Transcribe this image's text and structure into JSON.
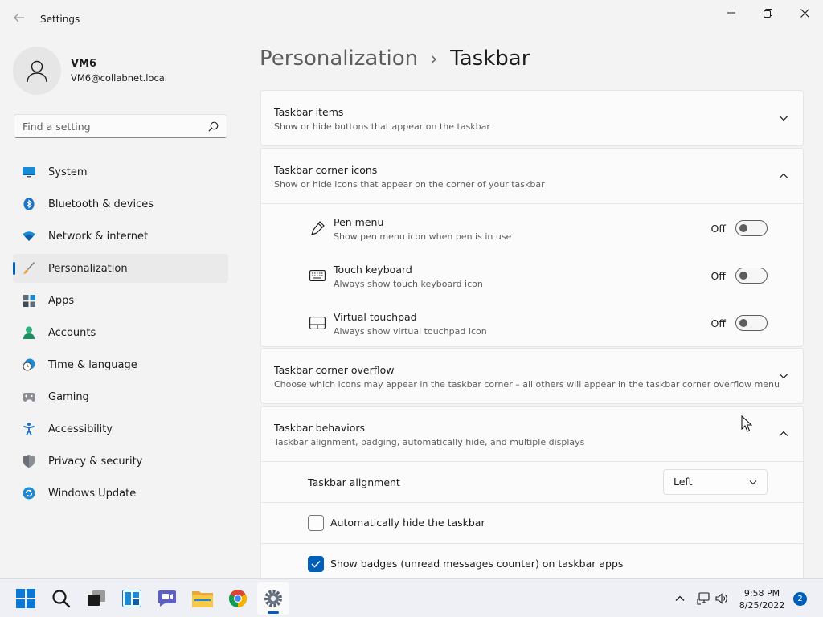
{
  "window": {
    "app_title": "Settings",
    "back_icon": "back-arrow-icon",
    "controls": [
      "minimize-icon",
      "restore-icon",
      "close-icon"
    ]
  },
  "profile": {
    "name": "VM6",
    "email": "VM6@collabnet.local"
  },
  "search": {
    "placeholder": "Find a setting",
    "value": ""
  },
  "sidebar": {
    "items": [
      {
        "label": "System",
        "icon": "monitor-icon",
        "active": false
      },
      {
        "label": "Bluetooth & devices",
        "icon": "bluetooth-icon",
        "active": false
      },
      {
        "label": "Network & internet",
        "icon": "wifi-icon",
        "active": false
      },
      {
        "label": "Personalization",
        "icon": "paintbrush-icon",
        "active": true
      },
      {
        "label": "Apps",
        "icon": "apps-icon",
        "active": false
      },
      {
        "label": "Accounts",
        "icon": "person-icon",
        "active": false
      },
      {
        "label": "Time & language",
        "icon": "clock-globe-icon",
        "active": false
      },
      {
        "label": "Gaming",
        "icon": "gamepad-icon",
        "active": false
      },
      {
        "label": "Accessibility",
        "icon": "accessibility-icon",
        "active": false
      },
      {
        "label": "Privacy & security",
        "icon": "shield-icon",
        "active": false
      },
      {
        "label": "Windows Update",
        "icon": "update-icon",
        "active": false
      }
    ]
  },
  "breadcrumb": {
    "parent": "Personalization",
    "separator": "›",
    "current": "Taskbar"
  },
  "sections": {
    "taskbar_items": {
      "title": "Taskbar items",
      "subtitle": "Show or hide buttons that appear on the taskbar",
      "expanded": false
    },
    "corner_icons": {
      "title": "Taskbar corner icons",
      "subtitle": "Show or hide icons that appear on the corner of your taskbar",
      "expanded": true,
      "rows": [
        {
          "title": "Pen menu",
          "subtitle": "Show pen menu icon when pen is in use",
          "state": "Off",
          "icon": "pen-icon"
        },
        {
          "title": "Touch keyboard",
          "subtitle": "Always show touch keyboard icon",
          "state": "Off",
          "icon": "keyboard-icon"
        },
        {
          "title": "Virtual touchpad",
          "subtitle": "Always show virtual touchpad icon",
          "state": "Off",
          "icon": "touchpad-icon"
        }
      ]
    },
    "corner_overflow": {
      "title": "Taskbar corner overflow",
      "subtitle": "Choose which icons may appear in the taskbar corner – all others will appear in the taskbar corner overflow menu",
      "expanded": false
    },
    "behaviors": {
      "title": "Taskbar behaviors",
      "subtitle": "Taskbar alignment, badging, automatically hide, and multiple displays",
      "expanded": true,
      "alignment_label": "Taskbar alignment",
      "alignment_value": "Left",
      "auto_hide_label": "Automatically hide the taskbar",
      "auto_hide_checked": false,
      "badges_label": "Show badges (unread messages counter) on taskbar apps",
      "badges_checked": true
    }
  },
  "taskbar": {
    "apps": [
      "start-icon",
      "search-icon",
      "task-view-icon",
      "widgets-icon",
      "chat-icon",
      "file-explorer-icon",
      "chrome-icon",
      "settings-icon"
    ],
    "time": "9:58 PM",
    "date": "8/25/2022",
    "notification_count": "2",
    "accent": "#005fb8"
  }
}
